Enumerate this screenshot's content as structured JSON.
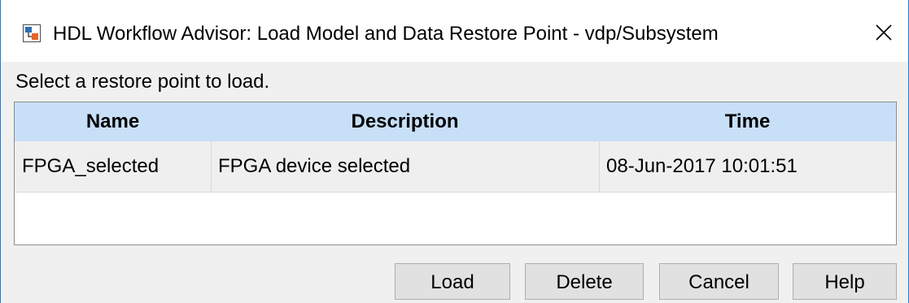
{
  "window": {
    "title": "HDL Workflow Advisor: Load Model and Data Restore Point - vdp/Subsystem",
    "app_icon": "matlab-simulink-icon",
    "close_glyph": "✕"
  },
  "instruction": "Select a restore point to load.",
  "table": {
    "headers": [
      "Name",
      "Description",
      "Time"
    ],
    "rows": [
      {
        "name": "FPGA_selected",
        "description": "FPGA device selected",
        "time": "08-Jun-2017 10:01:51"
      }
    ]
  },
  "buttons": {
    "load": "Load",
    "delete": "Delete",
    "cancel": "Cancel",
    "help": "Help"
  },
  "colors": {
    "header_bg": "#c7dff7",
    "window_border": "#1e7fd8",
    "button_bg": "#e1e1e1"
  }
}
